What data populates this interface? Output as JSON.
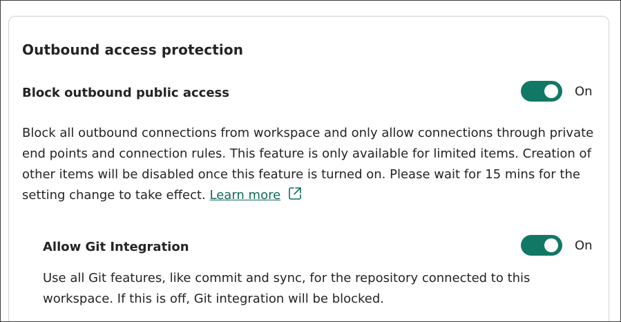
{
  "section": {
    "title": "Outbound access protection"
  },
  "block_outbound": {
    "label": "Block outbound public access",
    "toggle_state": "On",
    "enabled": true,
    "description": "Block all outbound connections from workspace and only allow connections through private end points and connection rules. This feature is only available for limited items. Creation of other items will be disabled once this feature is turned on. Please wait for 15 mins for the setting change to take effect.",
    "learn_more": "Learn more",
    "link_icon": "open-in-new-window-icon"
  },
  "git_integration": {
    "label": "Allow Git Integration",
    "toggle_state": "On",
    "enabled": true,
    "description": "Use all Git features, like commit and sync, for the repository connected to this workspace. If this is off, Git integration will be blocked."
  },
  "colors": {
    "toggle_on": "#117865",
    "link": "#0f6b5a",
    "text": "#242424",
    "card_border": "#d1d1d1"
  }
}
